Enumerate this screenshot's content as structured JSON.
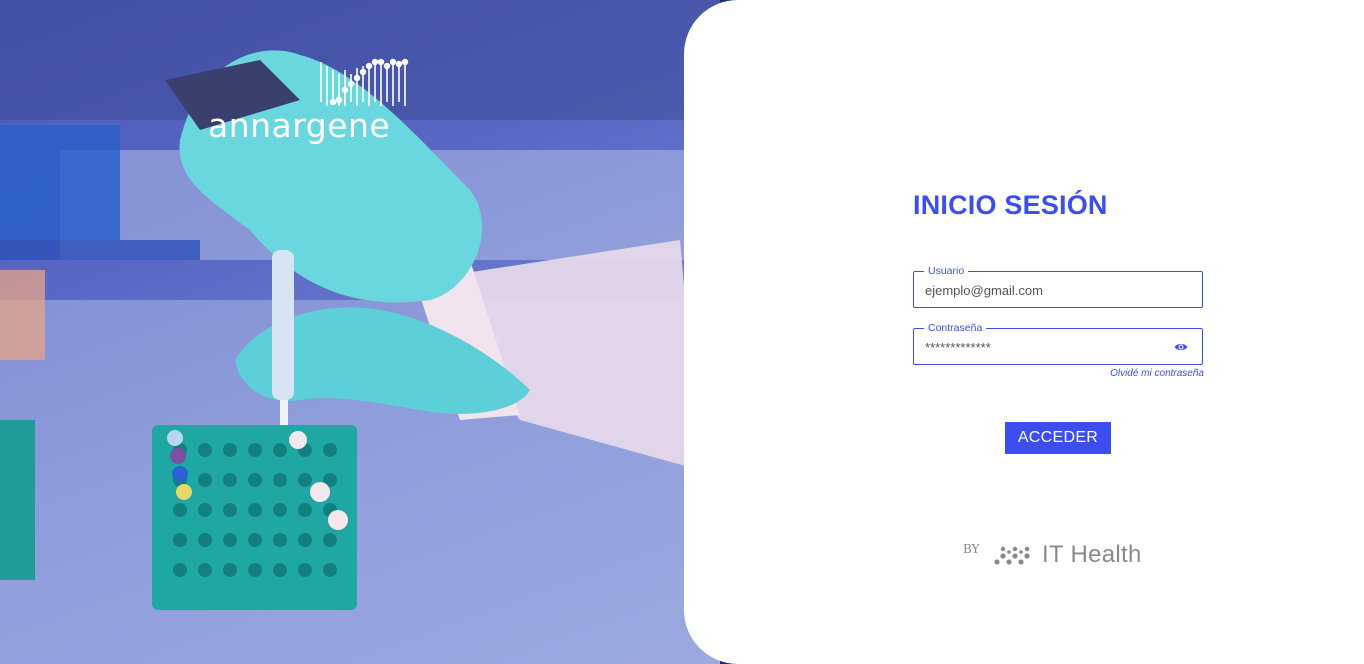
{
  "brand": {
    "name": "annargene"
  },
  "login": {
    "title": "INICIO SESIÓN",
    "username": {
      "label": "Usuario",
      "value": "ejemplo@gmail.com"
    },
    "password": {
      "label": "Contraseña",
      "value": "*************",
      "toggle_icon": "eye-icon"
    },
    "forgot_link": "Olvidé mi contraseña",
    "submit_label": "ACCEDER"
  },
  "footer": {
    "by": "BY",
    "company": "IT Health"
  },
  "colors": {
    "accent": "#3d4eee",
    "panel": "#ffffff",
    "hero_tint": "#4a57b6"
  }
}
